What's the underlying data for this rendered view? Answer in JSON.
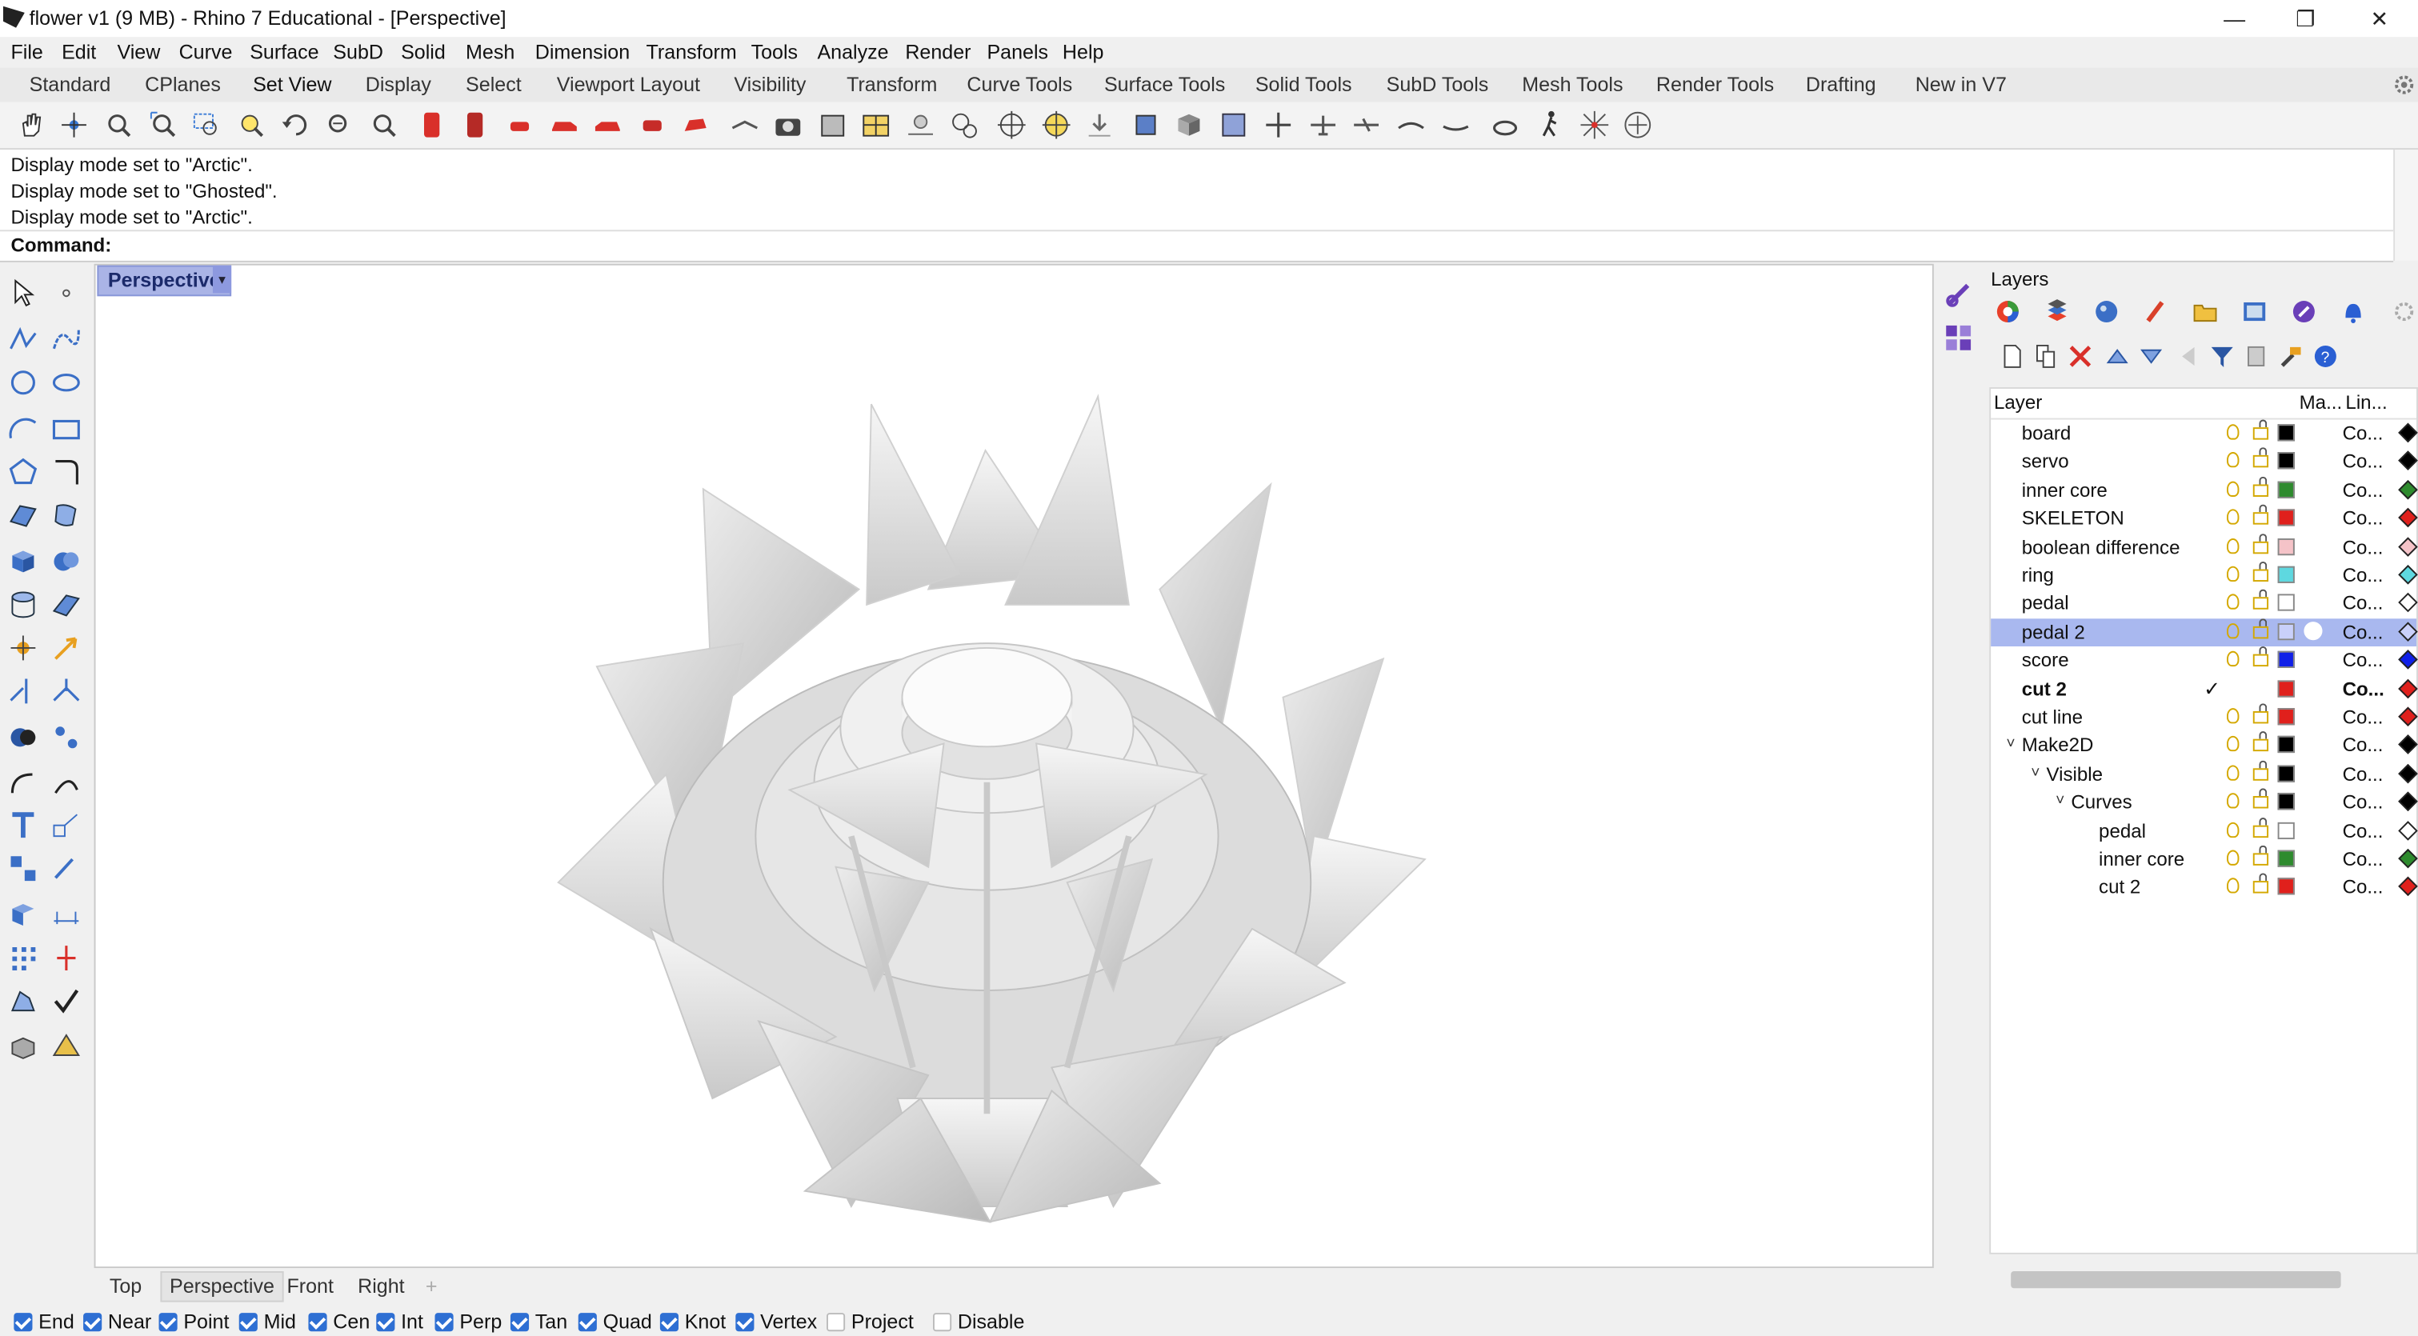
{
  "window": {
    "title": "flower v1 (9 MB) - Rhino 7 Educational - [Perspective]"
  },
  "menu": [
    "File",
    "Edit",
    "View",
    "Curve",
    "Surface",
    "SubD",
    "Solid",
    "Mesh",
    "Dimension",
    "Transform",
    "Tools",
    "Analyze",
    "Render",
    "Panels",
    "Help"
  ],
  "tabs": [
    "Standard",
    "CPlanes",
    "Set View",
    "Display",
    "Select",
    "Viewport Layout",
    "Visibility",
    "Transform",
    "Curve Tools",
    "Surface Tools",
    "Solid Tools",
    "SubD Tools",
    "Mesh Tools",
    "Render Tools",
    "Drafting",
    "New in V7"
  ],
  "active_tab": "Set View",
  "history": [
    "Display mode set to \"Arctic\".",
    "Display mode set to \"Ghosted\".",
    "Display mode set to \"Arctic\"."
  ],
  "command": {
    "label": "Command:",
    "value": ""
  },
  "viewport": {
    "title": "Perspective",
    "dropdown": "▾",
    "add": "+"
  },
  "view_tabs": [
    "Top",
    "Perspective",
    "Front",
    "Right"
  ],
  "active_view": "Perspective",
  "snaps": [
    {
      "label": "End",
      "on": true
    },
    {
      "label": "Near",
      "on": true
    },
    {
      "label": "Point",
      "on": true
    },
    {
      "label": "Mid",
      "on": true
    },
    {
      "label": "Cen",
      "on": true
    },
    {
      "label": "Int",
      "on": true
    },
    {
      "label": "Perp",
      "on": true
    },
    {
      "label": "Tan",
      "on": true
    },
    {
      "label": "Quad",
      "on": true
    },
    {
      "label": "Knot",
      "on": true
    },
    {
      "label": "Vertex",
      "on": true
    },
    {
      "label": "Project",
      "on": false
    },
    {
      "label": "Disable",
      "on": false
    }
  ],
  "layers_panel": {
    "title": "Layers",
    "columns": {
      "layer": "Layer",
      "material": "Ma...",
      "linetype": "Lin..."
    },
    "rows": [
      {
        "name": "board",
        "color": "#000000",
        "linetype": "Co..."
      },
      {
        "name": "servo",
        "color": "#000000",
        "linetype": "Co..."
      },
      {
        "name": "inner core",
        "color": "#2e8b2e",
        "linetype": "Co..."
      },
      {
        "name": "SKELETON",
        "color": "#e0201c",
        "linetype": "Co..."
      },
      {
        "name": "boolean difference",
        "color": "#f5c3c8",
        "linetype": "Co..."
      },
      {
        "name": "ring",
        "color": "#5ed8e0",
        "linetype": "Co..."
      },
      {
        "name": "pedal",
        "color": "#ffffff",
        "linetype": "Co..."
      },
      {
        "name": "pedal 2",
        "color": "#c9d0fa",
        "linetype": "Co...",
        "selected": true
      },
      {
        "name": "score",
        "color": "#1020e8",
        "linetype": "Co..."
      },
      {
        "name": "cut 2",
        "color": "#e0201c",
        "linetype": "Co...",
        "current": true,
        "check": "✓"
      },
      {
        "name": "cut line",
        "color": "#e0201c",
        "linetype": "Co..."
      },
      {
        "name": "Make2D",
        "color": "#000000",
        "linetype": "Co...",
        "expand": "˅"
      },
      {
        "name": "Visible",
        "color": "#000000",
        "linetype": "Co...",
        "expand": "˅"
      },
      {
        "name": "Curves",
        "color": "#000000",
        "linetype": "Co...",
        "expand": "˅"
      },
      {
        "name": "pedal",
        "color": "#ffffff",
        "linetype": "Co..."
      },
      {
        "name": "inner core",
        "color": "#2e8b2e",
        "linetype": "Co..."
      },
      {
        "name": "cut 2",
        "color": "#e0201c",
        "linetype": "Co..."
      }
    ]
  },
  "colors": {
    "accent": "#a9b8ef",
    "viewport_tab": "#aab4e6",
    "snap_check": "#2e6fd3"
  }
}
